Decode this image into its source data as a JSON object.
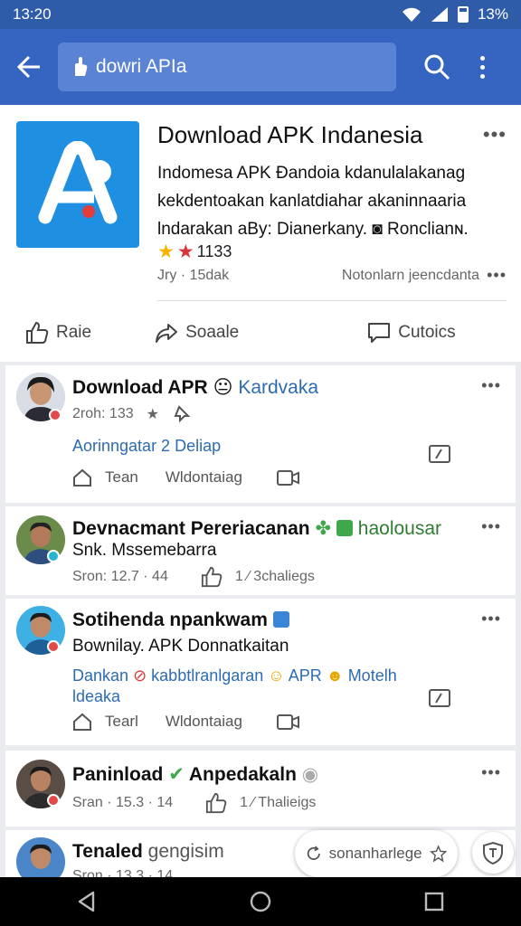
{
  "status_bar": {
    "time": "13:20",
    "battery": "13%"
  },
  "app_bar": {
    "search_value": "dowri APIa"
  },
  "app_header": {
    "title": "Download APK Indanesia",
    "description_lines": [
      "Indomesa APK Ɖandoia kdanulalakanag",
      "kekdentoakan kanlatdiahar akaninnaaria",
      "Ɩndarakan aBy: Dianerkany. ◙ Ronclianɴ."
    ],
    "rating": "1133",
    "meta_left": "Jry · 15dak",
    "meta_right": "Notonlarn jeencdanta",
    "actions": {
      "like": "Raie",
      "share": "Soaale",
      "comment": "Cutoics"
    }
  },
  "posts": [
    {
      "name": "Download APR",
      "emoji": "😐",
      "sub": "Kardvaka",
      "meta": "2roh: 133",
      "link_line1": "Aorinngatar 2 Deliap",
      "action_1": "Tean",
      "action_2": "Wldontaiag"
    },
    {
      "name": "Devnacmant Pereriacanan",
      "sub": "haolousar",
      "text": "Snk. Mssemebarra",
      "meta": "Sron: 12.7 · 44",
      "reactions": "1 ⁄ 3chaliegs"
    },
    {
      "name": "Sotihenda npankwam",
      "text": "Bownilay. APK Donnatkaitan",
      "link_a": "Dankan",
      "link_b": "kabbtlranlgaran",
      "link_c": "APR",
      "link_d": "Motelh",
      "link_line2": "ldeaka",
      "action_1": "Tearl",
      "action_2": "Wldontaiag"
    },
    {
      "name": "Paninload",
      "sub": "Anpedakaln",
      "meta": "Sran · 15.3 · 14",
      "reactions": "1 ⁄ Thalieigs"
    },
    {
      "name": "Tenaled",
      "sub": "gengisim",
      "meta": "Sron · 13.3 · 14"
    }
  ],
  "floating": {
    "label": "sonanharlege"
  },
  "colors": {
    "app_bar": "#3565c0",
    "status_bar": "#2f5ca8",
    "link": "#2d6bb3",
    "icon_blue": "#1e8fe1"
  }
}
